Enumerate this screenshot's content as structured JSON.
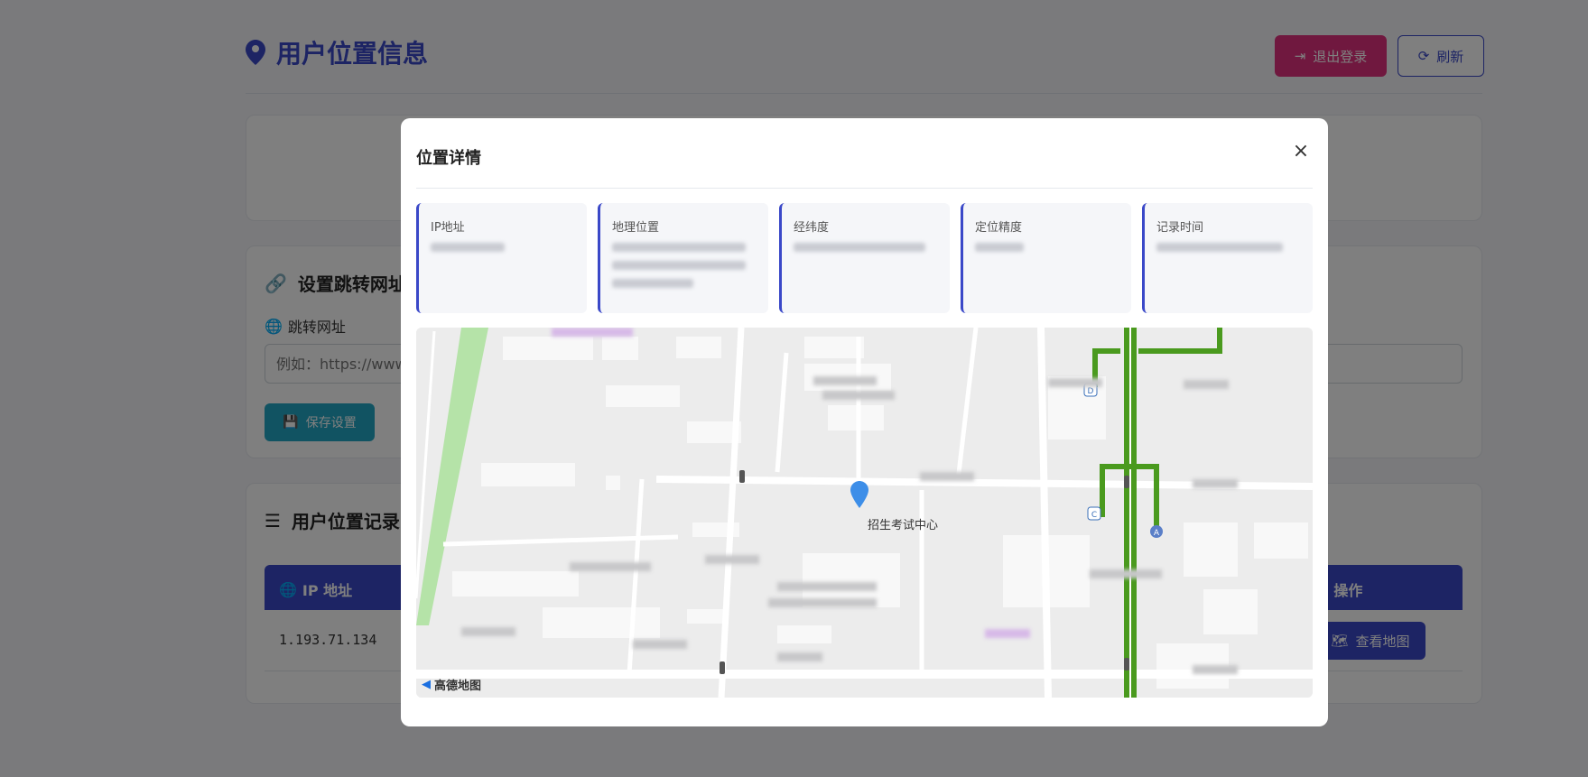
{
  "page": {
    "title": "用户位置信息",
    "header_buttons": {
      "logout": "退出登录",
      "refresh": "刷新"
    },
    "redirect_card": {
      "title": "设置跳转网址",
      "field_label": "跳转网址",
      "placeholder": "例如：https://www.",
      "save_button": "保存设置"
    },
    "records_card": {
      "title": "用户位置记录",
      "columns": {
        "ip": "IP 地址",
        "action": "操作"
      },
      "rows": [
        {
          "ip": "1.193.71.134",
          "action": "查看地图"
        }
      ]
    }
  },
  "modal": {
    "title": "位置详情",
    "close": "×",
    "info_cards": [
      {
        "label": "IP地址"
      },
      {
        "label": "地理位置"
      },
      {
        "label": "经纬度"
      },
      {
        "label": "定位精度"
      },
      {
        "label": "记录时间"
      }
    ],
    "map": {
      "poi_label": "招生考试中心",
      "provider": "高德地图",
      "metro_badges": [
        "D",
        "C",
        "A"
      ]
    }
  },
  "colors": {
    "primary": "#3a48c8",
    "logout": "#e0317e",
    "save": "#22a7c4",
    "metro_line": "#4a9a1e"
  }
}
